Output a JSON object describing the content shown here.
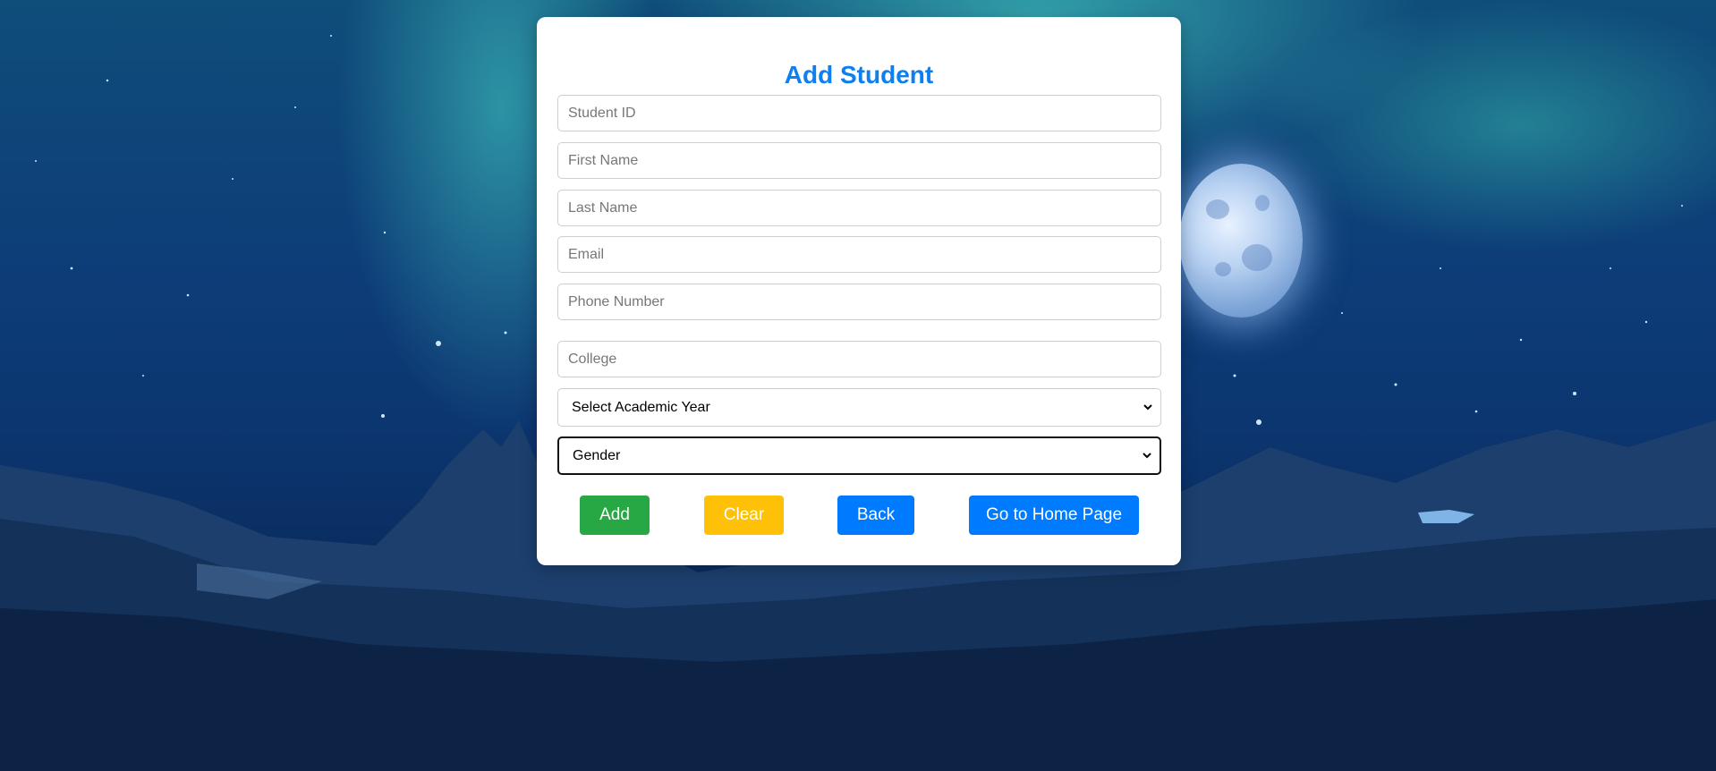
{
  "form": {
    "title": "Add Student",
    "fields": {
      "student_id": {
        "placeholder": "Student ID",
        "value": ""
      },
      "first_name": {
        "placeholder": "First Name",
        "value": ""
      },
      "last_name": {
        "placeholder": "Last Name",
        "value": ""
      },
      "email": {
        "placeholder": "Email",
        "value": ""
      },
      "phone": {
        "placeholder": "Phone Number",
        "value": ""
      },
      "college": {
        "placeholder": "College",
        "value": ""
      }
    },
    "academic_year": {
      "selected": "Select Academic Year"
    },
    "gender": {
      "selected": "Gender"
    },
    "buttons": {
      "add": "Add",
      "clear": "Clear",
      "back": "Back",
      "home": "Go to Home Page"
    }
  },
  "colors": {
    "title": "#0d7ff0",
    "add": "#28a745",
    "clear": "#ffc107",
    "primary": "#007bff"
  },
  "icons": {
    "select_arrow": "chevron-down-icon"
  }
}
